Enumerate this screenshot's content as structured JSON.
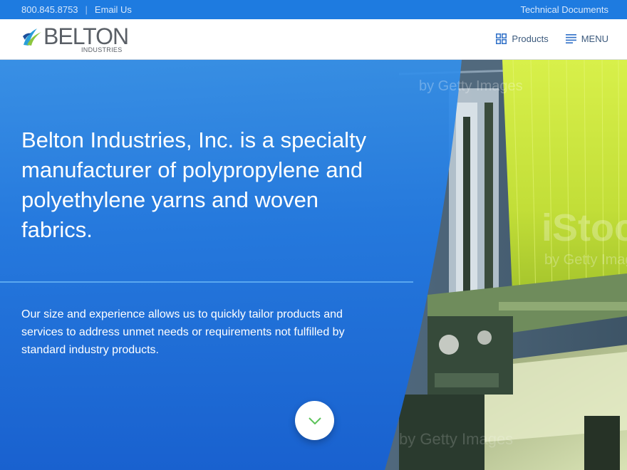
{
  "topbar": {
    "phone": "800.845.8753",
    "separator": "|",
    "email": "Email Us",
    "docs": "Technical Documents"
  },
  "logo": {
    "name": "BELTON",
    "sub": "INDUSTRIES"
  },
  "nav": {
    "products": "Products",
    "menu": "MENU"
  },
  "hero": {
    "headline": "Belton Industries, Inc. is a specialty manufacturer of polypropylene and polyethylene yarns and woven fabrics.",
    "subtext": "Our size and experience allows us to quickly tailor products and services to address unmet needs or requirements not fulfilled by standard industry products."
  },
  "watermark": {
    "brand": "iStock",
    "byline": "by Getty Images"
  },
  "icons": {
    "grid": "grid-icon",
    "menu": "hamburger-icon",
    "scroll": "chevron-down-icon"
  },
  "colors": {
    "topbar": "#1e7be0",
    "hero_blue": "#1f6fd9",
    "yarn_green": "#c8e83a",
    "chevron_green": "#5cc35a",
    "nav_blue": "#2e6fc7"
  }
}
